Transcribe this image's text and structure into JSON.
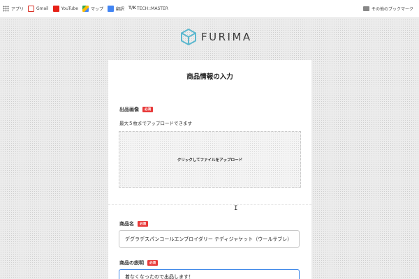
{
  "bookmarks": {
    "items": [
      {
        "label": "アプリ",
        "icon": "apps-grid-icon"
      },
      {
        "label": "Gmail",
        "icon": "gmail-icon"
      },
      {
        "label": "YouTube",
        "icon": "youtube-icon"
      },
      {
        "label": "マップ",
        "icon": "maps-icon"
      },
      {
        "label": "翻訳",
        "icon": "translate-icon"
      },
      {
        "label": "TECH::MASTER",
        "prefix": "T/K",
        "icon": "techmaster-icon"
      }
    ],
    "other": "その他のブックマーク"
  },
  "logo": {
    "text": "FURIMA",
    "icon": "cube-logo-icon",
    "color": "#5cb8cf"
  },
  "form": {
    "title": "商品情報の入力",
    "image_section": {
      "label": "出品画像",
      "required_badge": "必須",
      "help": "最大５枚までアップロードできます",
      "dropzone_text": "クリックしてファイルをアップロード"
    },
    "name_section": {
      "label": "商品名",
      "required_badge": "必須",
      "value": "デグラデスパンコールエンブロイダリー テディジャケット（ウールサブレ）"
    },
    "description_section": {
      "label": "商品の説明",
      "required_badge": "必須",
      "value": "着なくなったので出品します！"
    }
  },
  "colors": {
    "required": "#e83a3a",
    "focus": "#3b86e8"
  }
}
